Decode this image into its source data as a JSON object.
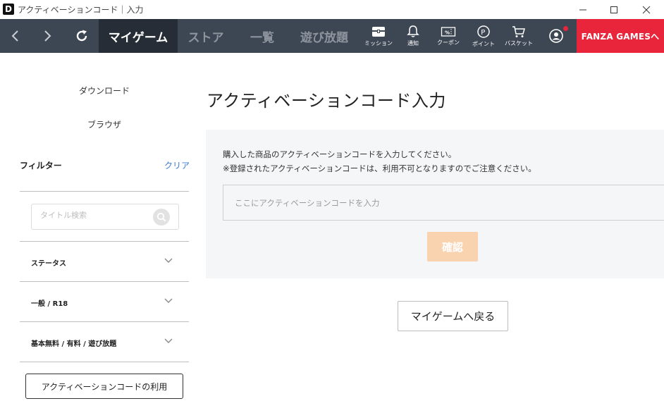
{
  "window": {
    "logo": "D",
    "title": "アクティベーションコード｜入力"
  },
  "nav": {
    "tabs": [
      {
        "label": "マイゲーム",
        "active": true
      },
      {
        "label": "ストア",
        "active": false
      },
      {
        "label": "一覧",
        "active": false
      },
      {
        "label": "遊び放題",
        "active": false
      }
    ],
    "icons": [
      {
        "name": "mission-icon",
        "label": "ミッション"
      },
      {
        "name": "bell-icon",
        "label": "通知"
      },
      {
        "name": "coupon-icon",
        "label": "クーポン"
      },
      {
        "name": "point-icon",
        "label": "ポイント"
      },
      {
        "name": "cart-icon",
        "label": "バスケット"
      }
    ],
    "fanza_button": "FANZA GAMESへ",
    "accent": "#e8253a"
  },
  "sidebar": {
    "links": [
      "ダウンロード",
      "ブラウザ"
    ],
    "filter_title": "フィルター",
    "filter_clear": "クリア",
    "search_placeholder": "タイトル検索",
    "accordions": [
      {
        "label": "ステータス"
      },
      {
        "label": "一般 / R18"
      },
      {
        "label": "基本無料 / 有料 / 遊び放題"
      }
    ],
    "activation_button": "アクティベーションコードの利用"
  },
  "main": {
    "title": "アクティベーションコード入力",
    "description_1": "購入した商品のアクティベーションコードを入力してください。",
    "description_2": "※登録されたアクティベーションコードは、利用不可となりますのでご注意ください。",
    "code_input_value": "",
    "code_input_placeholder": "ここにアクティベーションコードを入力",
    "confirm_button": "確認",
    "back_button": "マイゲームへ戻る"
  }
}
